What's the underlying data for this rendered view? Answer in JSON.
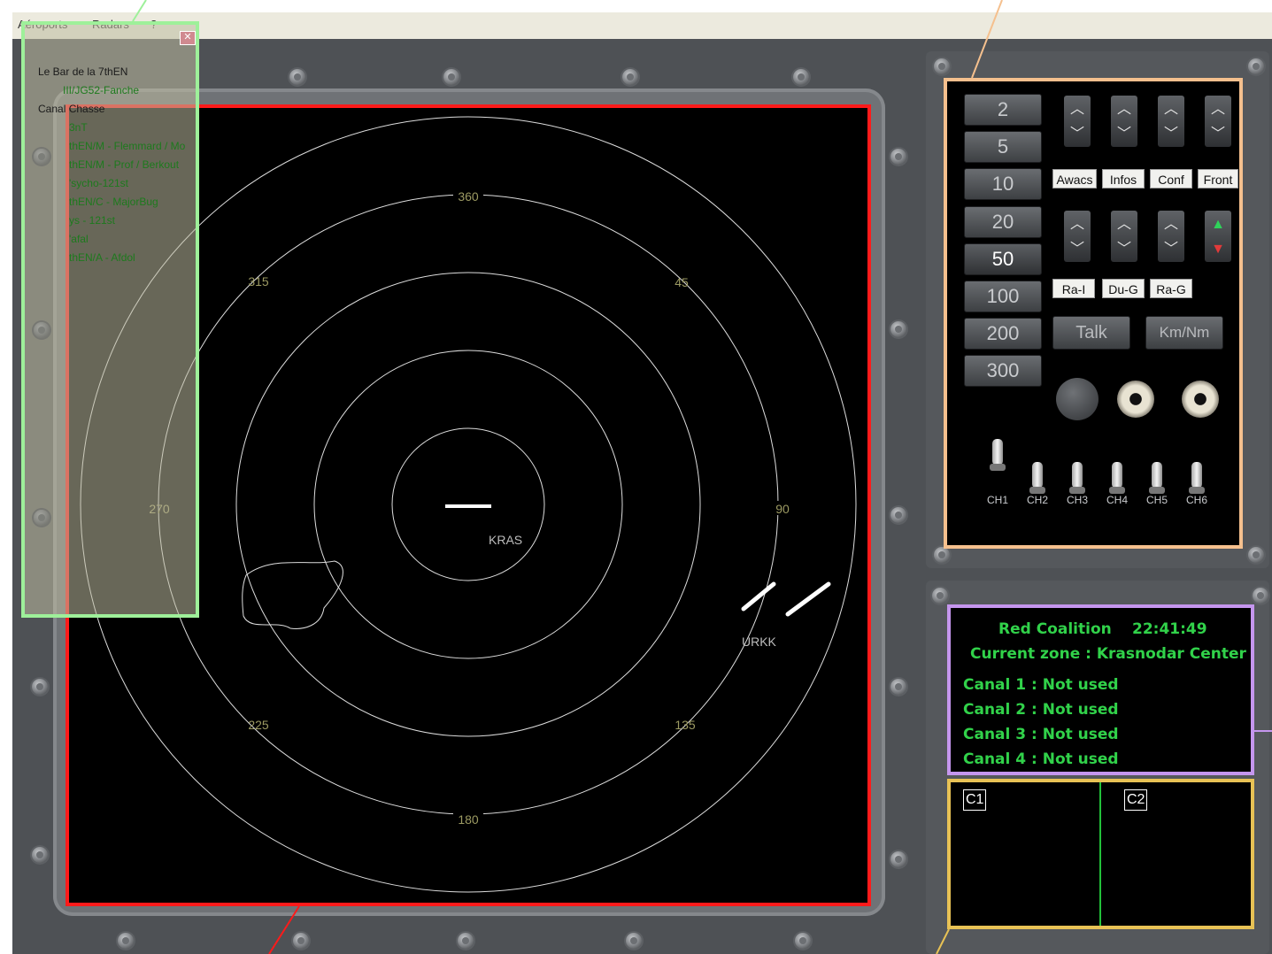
{
  "menu": {
    "items": [
      "Aéroports",
      "Radars",
      "?"
    ]
  },
  "radar": {
    "bearings": [
      "360",
      "45",
      "90",
      "135",
      "180",
      "225",
      "270",
      "315"
    ],
    "airfields": [
      "KRAS",
      "URKK"
    ]
  },
  "zoom": {
    "levels": [
      "2",
      "5",
      "10",
      "20",
      "50",
      "100",
      "200",
      "300"
    ],
    "selected": "50"
  },
  "toggles": {
    "row1": [
      "Awacs",
      "Infos",
      "Conf",
      "Front"
    ],
    "row2": [
      "Ra-I",
      "Du-G",
      "Ra-G"
    ]
  },
  "buttons": {
    "talk": "Talk",
    "units": "Km/Nm"
  },
  "channels": [
    "CH1",
    "CH2",
    "CH3",
    "CH4",
    "CH5",
    "CH6"
  ],
  "info": {
    "coalition": "Red Coalition",
    "time": "22:41:49",
    "zone": "Current zone : Krasnodar Center",
    "canals": [
      "Canal 1 : Not used",
      "Canal 2 : Not used",
      "Canal 3 : Not used",
      "Canal 4 : Not used"
    ]
  },
  "comm": {
    "c1": "C1",
    "c2": "C2"
  },
  "overlay": {
    "server": "Le Bar de la 7thEN",
    "server_user": "III/JG52-Fanche",
    "canal_label": "Canal Chasse",
    "users": [
      "3nT",
      "thEN/M - Flemmard / Mo",
      "thEN/M - Prof / Berkout",
      "'sycho-121st",
      "thEN/C - MajorBug",
      "ys - 121st",
      "'afal",
      "thEN/A - Afdol"
    ]
  },
  "colors": {
    "accent_red": "#ff1a1a",
    "green_text": "#31d24a",
    "radar_line": "#dddddd",
    "bearing_text": "#9c9a62"
  }
}
